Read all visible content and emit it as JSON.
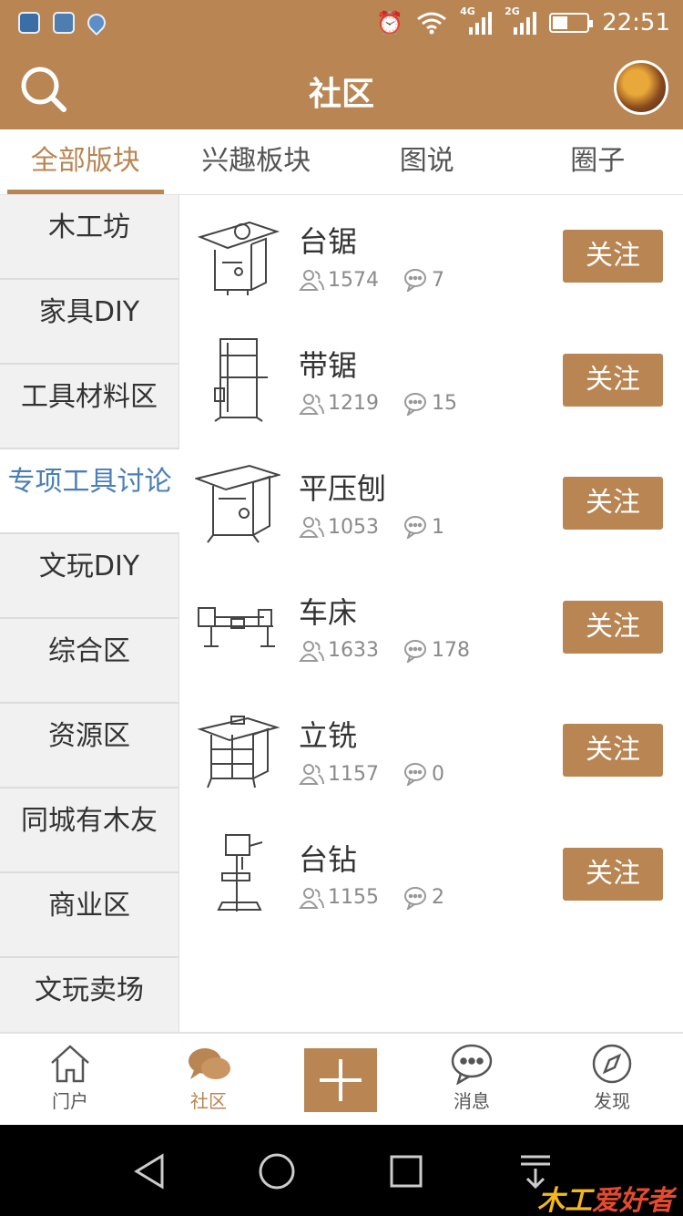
{
  "status_bar": {
    "time": "22:51",
    "net_1": "4G",
    "net_2": "2G"
  },
  "header": {
    "title": "社区",
    "search_icon": "search-icon",
    "avatar": "user-avatar"
  },
  "tabs": [
    {
      "label": "全部版块",
      "active": true
    },
    {
      "label": "兴趣板块",
      "active": false
    },
    {
      "label": "图说",
      "active": false
    },
    {
      "label": "圈子",
      "active": false
    }
  ],
  "sidebar": {
    "items": [
      {
        "label": "木工坊"
      },
      {
        "label": "家具DIY"
      },
      {
        "label": "工具材料区"
      },
      {
        "label": "专项工具讨论",
        "active": true
      },
      {
        "label": "文玩DIY"
      },
      {
        "label": "综合区"
      },
      {
        "label": "资源区"
      },
      {
        "label": "同城有木友"
      },
      {
        "label": "商业区"
      },
      {
        "label": "文玩卖场"
      }
    ]
  },
  "forums": [
    {
      "name": "台锯",
      "members": "1574",
      "posts": "7",
      "follow": "关注"
    },
    {
      "name": "带锯",
      "members": "1219",
      "posts": "15",
      "follow": "关注"
    },
    {
      "name": "平压刨",
      "members": "1053",
      "posts": "1",
      "follow": "关注"
    },
    {
      "name": "车床",
      "members": "1633",
      "posts": "178",
      "follow": "关注"
    },
    {
      "name": "立铣",
      "members": "1157",
      "posts": "0",
      "follow": "关注"
    },
    {
      "name": "台钻",
      "members": "1155",
      "posts": "2",
      "follow": "关注"
    }
  ],
  "bottom_nav": {
    "home": "门户",
    "community": "社区",
    "messages": "消息",
    "discover": "发现"
  },
  "watermark": {
    "mark": "木工",
    "text": "爱好者"
  },
  "colors": {
    "brand": "#b88553",
    "active_side": "#4a7fb5"
  }
}
